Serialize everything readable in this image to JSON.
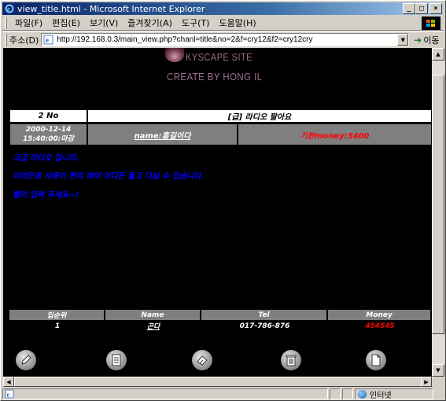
{
  "window": {
    "title": "view_title.html - Microsoft Internet Explorer",
    "minimize": "_",
    "maximize": "□",
    "close": "×"
  },
  "menu": {
    "items": [
      "파일(F)",
      "편집(E)",
      "보기(V)",
      "즐겨찾기(A)",
      "도구(T)",
      "도움말(H)"
    ]
  },
  "address": {
    "label": "주소(D)",
    "url": "http://192.168.0.3/main_view.php?chanl=title&no=2&f=cry12&f2=cry12cry",
    "go_label": "이동"
  },
  "logo": {
    "line1": "KYSCAPE SITE",
    "line2": "CREATE BY HONG IL"
  },
  "post": {
    "no": "2 No",
    "subject": "[급] 라디오 팔아요",
    "date_line1": "2000-12-14",
    "date_line2": "15:40:00:마감",
    "name": "name:홍길이다",
    "money": "기본money:3400",
    "body": [
      "고급 라디오 입니다.",
      "이러모로 사용이 편리 하며 어디든 들고 다닐 수 있습니다.",
      "빨리 입력 주세요~!"
    ]
  },
  "bids": {
    "headers": [
      "입순위",
      "Name",
      "Tel",
      "Money"
    ],
    "rows": [
      {
        "rank": "1",
        "name": "곤다",
        "tel": "017-786-876",
        "money": "454545"
      }
    ]
  },
  "actions": [
    {
      "icon": "pencil-icon",
      "name": "write-button"
    },
    {
      "icon": "list-icon",
      "name": "list-button"
    },
    {
      "icon": "eraser-icon",
      "name": "edit-button"
    },
    {
      "icon": "trash-icon",
      "name": "delete-button"
    },
    {
      "icon": "document-icon",
      "name": "new-page-button"
    }
  ],
  "status": {
    "text": "",
    "zone": "인터넷"
  },
  "colors": {
    "titlebar": "#0a246a",
    "page_background": "#000000",
    "body_text": "#0000ff",
    "money_text": "#ff0000",
    "info_row": "#7f7f7f"
  }
}
